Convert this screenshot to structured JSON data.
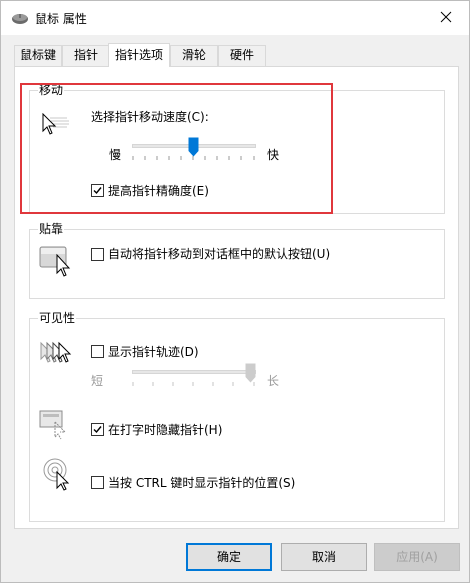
{
  "window": {
    "title": "鼠标 属性",
    "icon": "mouse-icon",
    "close_icon": "close-icon"
  },
  "tabs": [
    {
      "label": "鼠标键"
    },
    {
      "label": "指针"
    },
    {
      "label": "指针选项"
    },
    {
      "label": "滑轮"
    },
    {
      "label": "硬件"
    }
  ],
  "active_tab": "指针选项",
  "motion": {
    "group_title": "移动",
    "speed_label": "选择指针移动速度(C):",
    "slow_label": "慢",
    "fast_label": "快",
    "speed_level": 0.5,
    "precision_label": "提高指针精确度(E)",
    "precision_checked": true
  },
  "snap": {
    "group_title": "贴靠",
    "snap_label": "自动将指针移动到对话框中的默认按钮(U)",
    "snap_checked": false
  },
  "visibility": {
    "group_title": "可见性",
    "trails_label": "显示指针轨迹(D)",
    "trails_checked": false,
    "short_label": "短",
    "long_label": "长",
    "trails_level": 1.0,
    "hide_label": "在打字时隐藏指针(H)",
    "hide_checked": true,
    "ctrl_label": "当按 CTRL 键时显示指针的位置(S)",
    "ctrl_checked": false
  },
  "buttons": {
    "ok": "确定",
    "cancel": "取消",
    "apply": "应用(A)"
  },
  "colors": {
    "accent": "#0078d7",
    "highlight_box": "#e0373c"
  }
}
